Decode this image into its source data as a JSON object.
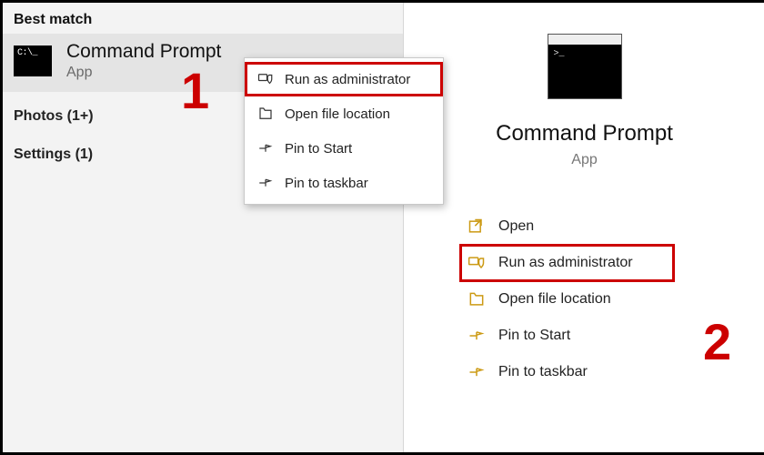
{
  "best_match_header": "Best match",
  "app": {
    "name": "Command Prompt",
    "type": "App"
  },
  "photos_header": "Photos (1+)",
  "settings_header": "Settings (1)",
  "context_menu": {
    "items": [
      {
        "label": "Run as administrator",
        "icon": "shield",
        "highlight": true
      },
      {
        "label": "Open file location",
        "icon": "folder"
      },
      {
        "label": "Pin to Start",
        "icon": "pin"
      },
      {
        "label": "Pin to taskbar",
        "icon": "pin"
      }
    ]
  },
  "right_actions": {
    "items": [
      {
        "label": "Open",
        "icon": "open"
      },
      {
        "label": "Run as administrator",
        "icon": "shield",
        "highlight": true
      },
      {
        "label": "Open file location",
        "icon": "folder"
      },
      {
        "label": "Pin to Start",
        "icon": "pin"
      },
      {
        "label": "Pin to taskbar",
        "icon": "pin"
      }
    ]
  },
  "annotations": {
    "one": "1",
    "two": "2"
  }
}
